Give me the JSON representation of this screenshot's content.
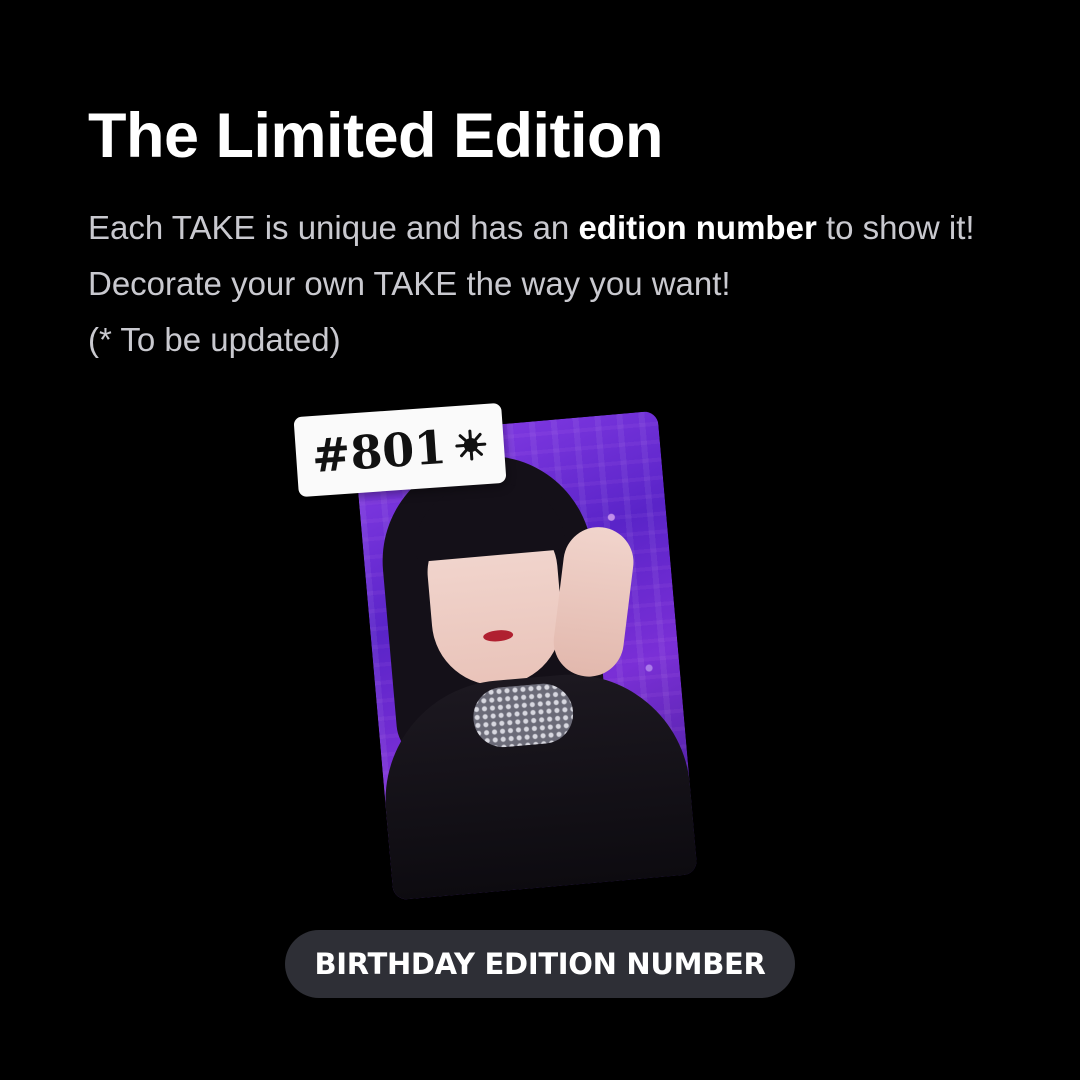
{
  "header": {
    "title": "The Limited Edition"
  },
  "description": {
    "part1": "Each TAKE is unique and has an ",
    "bold": "edition number",
    "part2": " to show it! Decorate your own TAKE the way you want!",
    "note": "(* To be updated)"
  },
  "card": {
    "badge_number": "#801",
    "badge_icon": "sparkle-star-icon"
  },
  "label": {
    "text": "BIRTHDAY EDITION NUMBER"
  },
  "colors": {
    "background": "#000000",
    "pill": "#2e2f36",
    "card_accent": "#7a2fd6"
  }
}
